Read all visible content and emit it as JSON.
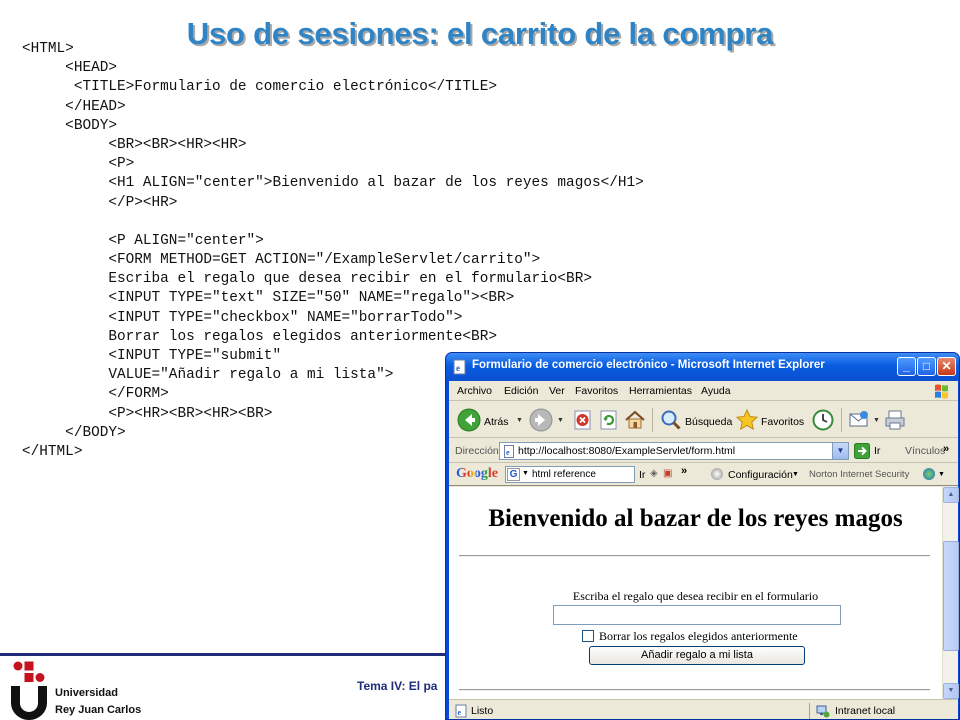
{
  "slide": {
    "title": "Uso de sesiones: el carrito de la compra",
    "code_lines": [
      "<HTML>",
      "     <HEAD>",
      "      <TITLE>Formulario de comercio electrónico</TITLE>",
      "     </HEAD>",
      "     <BODY>",
      "          <BR><BR><HR><HR>",
      "          <P>",
      "          <H1 ALIGN=\"center\">Bienvenido al bazar de los reyes magos</H1>",
      "          </P><HR>",
      "",
      "          <P ALIGN=\"center\">",
      "          <FORM METHOD=GET ACTION=\"/ExampleServlet/carrito\">",
      "          Escriba el regalo que desea recibir en el formulario<BR>",
      "          <INPUT TYPE=\"text\" SIZE=\"50\" NAME=\"regalo\"><BR>",
      "          <INPUT TYPE=\"checkbox\" NAME=\"borrarTodo\">",
      "          Borrar los regalos elegidos anteriormente<BR>",
      "          <INPUT TYPE=\"submit\"",
      "          VALUE=\"Añadir regalo a mi lista\">",
      "          </FORM>",
      "          <P><HR><BR><HR><BR>",
      "     </BODY>",
      "</HTML>"
    ],
    "footer_text": "Tema IV: El pa",
    "university_line1": "Universidad",
    "university_line2": "Rey Juan Carlos"
  },
  "browser": {
    "window_title": "Formulario de comercio electrónico - Microsoft Internet Explorer",
    "menu": [
      "Archivo",
      "Edición",
      "Ver",
      "Favoritos",
      "Herramientas",
      "Ayuda"
    ],
    "toolbar": {
      "back_label": "Atrás",
      "search_label": "Búsqueda",
      "favorites_label": "Favoritos"
    },
    "address": {
      "label": "Dirección",
      "url": "http://localhost:8080/ExampleServlet/form.html",
      "go_label": "Ir",
      "links_label": "Vínculos"
    },
    "google_bar": {
      "logo": "Google",
      "query": "html reference",
      "go_label": "Ir",
      "settings_label": "Configuración",
      "norton_label": "Norton Internet Security"
    },
    "page": {
      "heading": "Bienvenido al bazar de los reyes magos",
      "prompt": "Escriba el regalo que desea recibir en el formulario",
      "text_input_value": "",
      "checkbox_label": "Borrar los regalos elegidos anteriormente",
      "checkbox_checked": false,
      "submit_label": "Añadir regalo a mi lista"
    },
    "status": {
      "text": "Listo",
      "zone": "Intranet local"
    }
  },
  "colors": {
    "title_blue": "#2f84c6",
    "footer_navy": "#1f2d7a",
    "logo_red": "#c4121f",
    "xp_titlebar": "#0a5ce0"
  }
}
